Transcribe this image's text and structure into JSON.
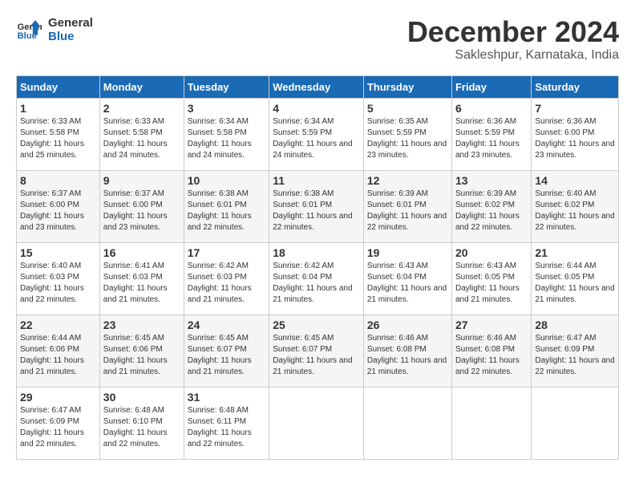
{
  "logo": {
    "line1": "General",
    "line2": "Blue"
  },
  "title": "December 2024",
  "location": "Sakleshpur, Karnataka, India",
  "headers": [
    "Sunday",
    "Monday",
    "Tuesday",
    "Wednesday",
    "Thursday",
    "Friday",
    "Saturday"
  ],
  "weeks": [
    [
      {
        "day": "1",
        "sunrise": "6:33 AM",
        "sunset": "5:58 PM",
        "daylight": "11 hours and 25 minutes."
      },
      {
        "day": "2",
        "sunrise": "6:33 AM",
        "sunset": "5:58 PM",
        "daylight": "11 hours and 24 minutes."
      },
      {
        "day": "3",
        "sunrise": "6:34 AM",
        "sunset": "5:58 PM",
        "daylight": "11 hours and 24 minutes."
      },
      {
        "day": "4",
        "sunrise": "6:34 AM",
        "sunset": "5:59 PM",
        "daylight": "11 hours and 24 minutes."
      },
      {
        "day": "5",
        "sunrise": "6:35 AM",
        "sunset": "5:59 PM",
        "daylight": "11 hours and 23 minutes."
      },
      {
        "day": "6",
        "sunrise": "6:36 AM",
        "sunset": "5:59 PM",
        "daylight": "11 hours and 23 minutes."
      },
      {
        "day": "7",
        "sunrise": "6:36 AM",
        "sunset": "6:00 PM",
        "daylight": "11 hours and 23 minutes."
      }
    ],
    [
      {
        "day": "8",
        "sunrise": "6:37 AM",
        "sunset": "6:00 PM",
        "daylight": "11 hours and 23 minutes."
      },
      {
        "day": "9",
        "sunrise": "6:37 AM",
        "sunset": "6:00 PM",
        "daylight": "11 hours and 23 minutes."
      },
      {
        "day": "10",
        "sunrise": "6:38 AM",
        "sunset": "6:01 PM",
        "daylight": "11 hours and 22 minutes."
      },
      {
        "day": "11",
        "sunrise": "6:38 AM",
        "sunset": "6:01 PM",
        "daylight": "11 hours and 22 minutes."
      },
      {
        "day": "12",
        "sunrise": "6:39 AM",
        "sunset": "6:01 PM",
        "daylight": "11 hours and 22 minutes."
      },
      {
        "day": "13",
        "sunrise": "6:39 AM",
        "sunset": "6:02 PM",
        "daylight": "11 hours and 22 minutes."
      },
      {
        "day": "14",
        "sunrise": "6:40 AM",
        "sunset": "6:02 PM",
        "daylight": "11 hours and 22 minutes."
      }
    ],
    [
      {
        "day": "15",
        "sunrise": "6:40 AM",
        "sunset": "6:03 PM",
        "daylight": "11 hours and 22 minutes."
      },
      {
        "day": "16",
        "sunrise": "6:41 AM",
        "sunset": "6:03 PM",
        "daylight": "11 hours and 21 minutes."
      },
      {
        "day": "17",
        "sunrise": "6:42 AM",
        "sunset": "6:03 PM",
        "daylight": "11 hours and 21 minutes."
      },
      {
        "day": "18",
        "sunrise": "6:42 AM",
        "sunset": "6:04 PM",
        "daylight": "11 hours and 21 minutes."
      },
      {
        "day": "19",
        "sunrise": "6:43 AM",
        "sunset": "6:04 PM",
        "daylight": "11 hours and 21 minutes."
      },
      {
        "day": "20",
        "sunrise": "6:43 AM",
        "sunset": "6:05 PM",
        "daylight": "11 hours and 21 minutes."
      },
      {
        "day": "21",
        "sunrise": "6:44 AM",
        "sunset": "6:05 PM",
        "daylight": "11 hours and 21 minutes."
      }
    ],
    [
      {
        "day": "22",
        "sunrise": "6:44 AM",
        "sunset": "6:06 PM",
        "daylight": "11 hours and 21 minutes."
      },
      {
        "day": "23",
        "sunrise": "6:45 AM",
        "sunset": "6:06 PM",
        "daylight": "11 hours and 21 minutes."
      },
      {
        "day": "24",
        "sunrise": "6:45 AM",
        "sunset": "6:07 PM",
        "daylight": "11 hours and 21 minutes."
      },
      {
        "day": "25",
        "sunrise": "6:45 AM",
        "sunset": "6:07 PM",
        "daylight": "11 hours and 21 minutes."
      },
      {
        "day": "26",
        "sunrise": "6:46 AM",
        "sunset": "6:08 PM",
        "daylight": "11 hours and 21 minutes."
      },
      {
        "day": "27",
        "sunrise": "6:46 AM",
        "sunset": "6:08 PM",
        "daylight": "11 hours and 22 minutes."
      },
      {
        "day": "28",
        "sunrise": "6:47 AM",
        "sunset": "6:09 PM",
        "daylight": "11 hours and 22 minutes."
      }
    ],
    [
      {
        "day": "29",
        "sunrise": "6:47 AM",
        "sunset": "6:09 PM",
        "daylight": "11 hours and 22 minutes."
      },
      {
        "day": "30",
        "sunrise": "6:48 AM",
        "sunset": "6:10 PM",
        "daylight": "11 hours and 22 minutes."
      },
      {
        "day": "31",
        "sunrise": "6:48 AM",
        "sunset": "6:11 PM",
        "daylight": "11 hours and 22 minutes."
      },
      null,
      null,
      null,
      null
    ]
  ]
}
